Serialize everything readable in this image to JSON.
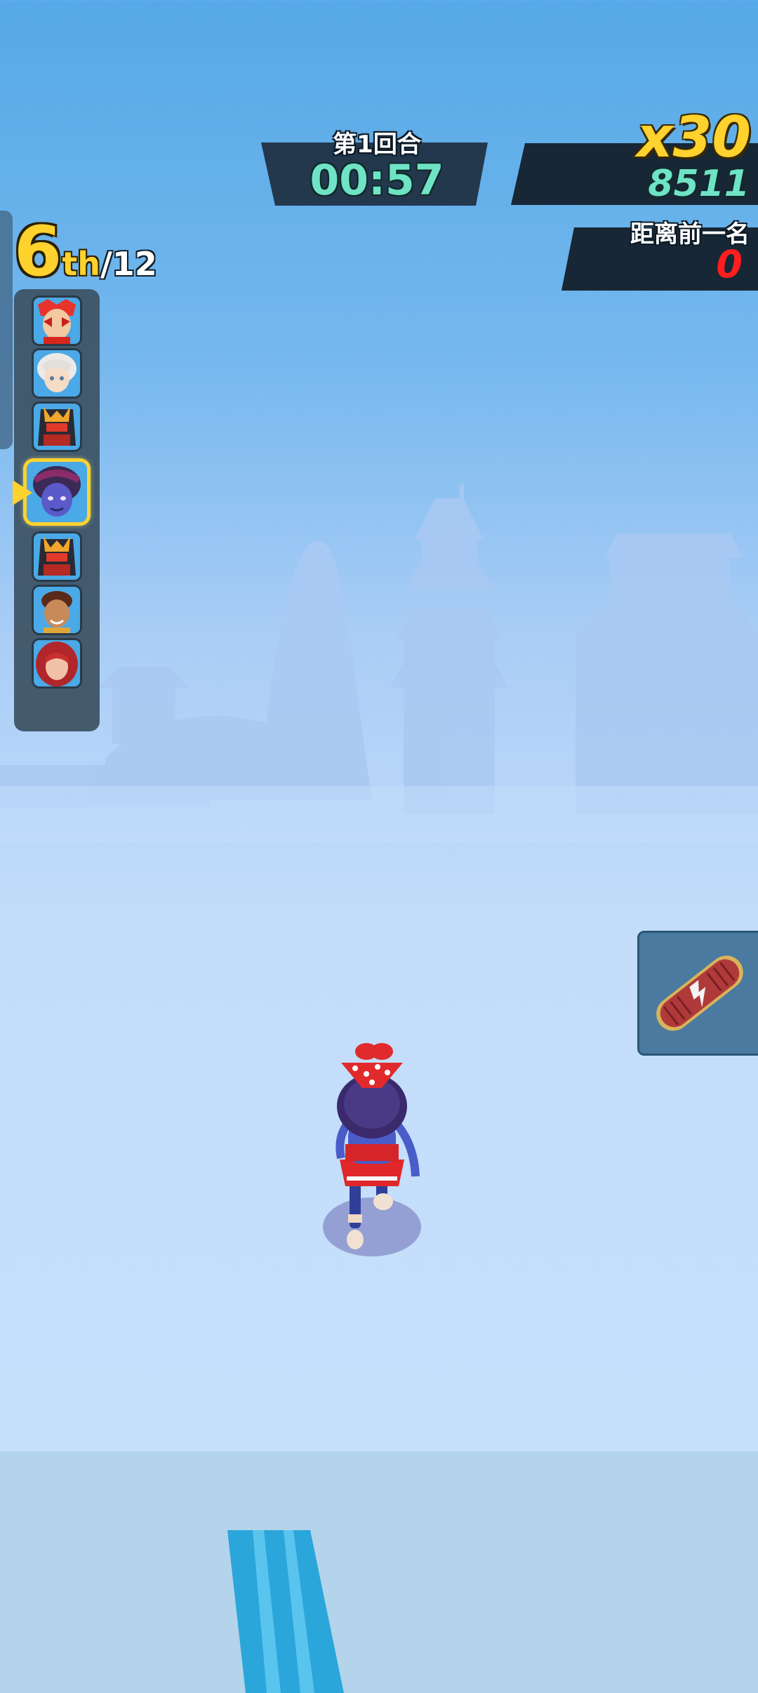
{
  "hud": {
    "round_label": "第1回合",
    "timer": "00:57",
    "combo": "x30",
    "score": "8511",
    "gap_label": "距离前一名",
    "gap_value": "0"
  },
  "rank": {
    "position": "6",
    "suffix": "th",
    "total": "/12"
  },
  "leaderboard": [
    {
      "name": "racer-1-red-face",
      "current": false
    },
    {
      "name": "racer-2-white-hair",
      "current": false
    },
    {
      "name": "racer-3-armored-helmet",
      "current": false
    },
    {
      "name": "racer-4-purple-girl",
      "current": true
    },
    {
      "name": "racer-5-armored-helmet",
      "current": false
    },
    {
      "name": "racer-6-brown-boy",
      "current": false
    },
    {
      "name": "racer-7-red-hair",
      "current": false
    }
  ],
  "item": {
    "icon": "skateboard-icon"
  },
  "colors": {
    "accent_yellow": "#ffd22e",
    "timer_green": "#6fe3c5",
    "gap_red": "#ff1e1e",
    "panel_dark": "#172736"
  }
}
